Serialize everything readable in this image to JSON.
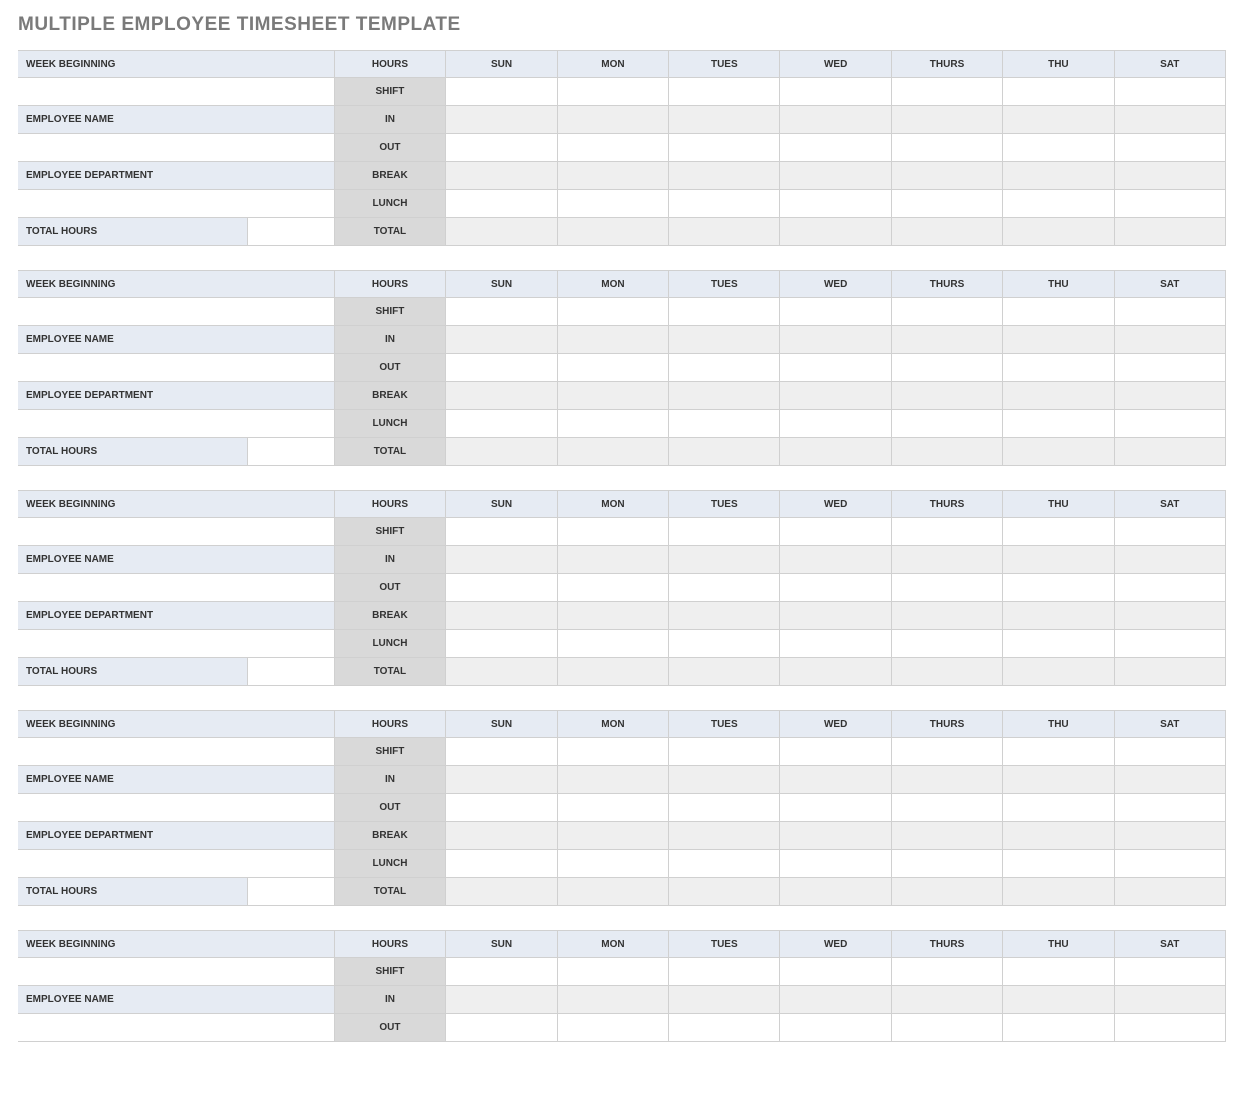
{
  "title": "MULTIPLE EMPLOYEE TIMESHEET TEMPLATE",
  "labels": {
    "week_beginning": "WEEK BEGINNING",
    "employee_name": "EMPLOYEE NAME",
    "employee_department": "EMPLOYEE DEPARTMENT",
    "total_hours": "TOTAL HOURS",
    "hours": "HOURS",
    "shift": "SHIFT",
    "in": "IN",
    "out": "OUT",
    "break": "BREAK",
    "lunch": "LUNCH",
    "total": "TOTAL"
  },
  "days": [
    "SUN",
    "MON",
    "TUES",
    "WED",
    "THURS",
    "THU",
    "SAT"
  ],
  "blocks": [
    {
      "week_beginning": "",
      "employee_name": "",
      "employee_department": "",
      "total_hours": "",
      "shift": [
        "",
        "",
        "",
        "",
        "",
        "",
        ""
      ],
      "in": [
        "",
        "",
        "",
        "",
        "",
        "",
        ""
      ],
      "out": [
        "",
        "",
        "",
        "",
        "",
        "",
        ""
      ],
      "break": [
        "",
        "",
        "",
        "",
        "",
        "",
        ""
      ],
      "lunch": [
        "",
        "",
        "",
        "",
        "",
        "",
        ""
      ],
      "total": [
        "",
        "",
        "",
        "",
        "",
        "",
        ""
      ],
      "rows_shown": 7
    },
    {
      "week_beginning": "",
      "employee_name": "",
      "employee_department": "",
      "total_hours": "",
      "shift": [
        "",
        "",
        "",
        "",
        "",
        "",
        ""
      ],
      "in": [
        "",
        "",
        "",
        "",
        "",
        "",
        ""
      ],
      "out": [
        "",
        "",
        "",
        "",
        "",
        "",
        ""
      ],
      "break": [
        "",
        "",
        "",
        "",
        "",
        "",
        ""
      ],
      "lunch": [
        "",
        "",
        "",
        "",
        "",
        "",
        ""
      ],
      "total": [
        "",
        "",
        "",
        "",
        "",
        "",
        ""
      ],
      "rows_shown": 7
    },
    {
      "week_beginning": "",
      "employee_name": "",
      "employee_department": "",
      "total_hours": "",
      "shift": [
        "",
        "",
        "",
        "",
        "",
        "",
        ""
      ],
      "in": [
        "",
        "",
        "",
        "",
        "",
        "",
        ""
      ],
      "out": [
        "",
        "",
        "",
        "",
        "",
        "",
        ""
      ],
      "break": [
        "",
        "",
        "",
        "",
        "",
        "",
        ""
      ],
      "lunch": [
        "",
        "",
        "",
        "",
        "",
        "",
        ""
      ],
      "total": [
        "",
        "",
        "",
        "",
        "",
        "",
        ""
      ],
      "rows_shown": 7
    },
    {
      "week_beginning": "",
      "employee_name": "",
      "employee_department": "",
      "total_hours": "",
      "shift": [
        "",
        "",
        "",
        "",
        "",
        "",
        ""
      ],
      "in": [
        "",
        "",
        "",
        "",
        "",
        "",
        ""
      ],
      "out": [
        "",
        "",
        "",
        "",
        "",
        "",
        ""
      ],
      "break": [
        "",
        "",
        "",
        "",
        "",
        "",
        ""
      ],
      "lunch": [
        "",
        "",
        "",
        "",
        "",
        "",
        ""
      ],
      "total": [
        "",
        "",
        "",
        "",
        "",
        "",
        ""
      ],
      "rows_shown": 7
    },
    {
      "week_beginning": "",
      "employee_name": "",
      "employee_department": "",
      "total_hours": "",
      "shift": [
        "",
        "",
        "",
        "",
        "",
        "",
        ""
      ],
      "in": [
        "",
        "",
        "",
        "",
        "",
        "",
        ""
      ],
      "out": [
        "",
        "",
        "",
        "",
        "",
        "",
        ""
      ],
      "break": [
        "",
        "",
        "",
        "",
        "",
        "",
        ""
      ],
      "lunch": [
        "",
        "",
        "",
        "",
        "",
        "",
        ""
      ],
      "total": [
        "",
        "",
        "",
        "",
        "",
        "",
        ""
      ],
      "rows_shown": 4
    }
  ]
}
